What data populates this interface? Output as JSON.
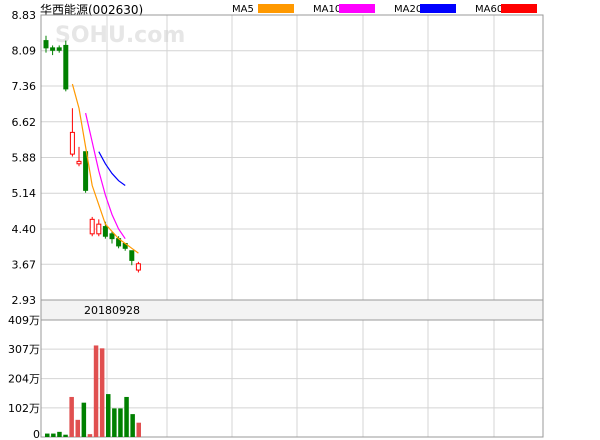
{
  "window": {
    "title": "华西能源(002630)"
  },
  "watermark": "SOHU.com",
  "legend": [
    {
      "label": "MA5",
      "color": "#ff9900"
    },
    {
      "label": "MA10",
      "color": "#ff00ff"
    },
    {
      "label": "MA20",
      "color": "#0000ff"
    },
    {
      "label": "MA60",
      "color": "#ff0000"
    }
  ],
  "date_label": "20180928",
  "colors": {
    "up": "#ff0000",
    "down": "#008000",
    "grid": "#d4d4d4",
    "axis": "#999999",
    "volume_up": "#e05050"
  },
  "chart_data": [
    {
      "type": "candlestick",
      "title": "华西能源(002630)",
      "ylim": [
        2.93,
        8.83
      ],
      "yticks": [
        "8.83",
        "8.09",
        "7.36",
        "6.62",
        "5.88",
        "5.14",
        "4.40",
        "3.67",
        "2.93"
      ],
      "candles": [
        {
          "open": 8.3,
          "close": 8.15,
          "high": 8.4,
          "low": 8.05
        },
        {
          "open": 8.15,
          "close": 8.1,
          "high": 8.2,
          "low": 8.0
        },
        {
          "open": 8.15,
          "close": 8.1,
          "high": 8.2,
          "low": 8.05
        },
        {
          "open": 8.2,
          "close": 7.3,
          "high": 8.3,
          "low": 7.25
        },
        {
          "open": 5.95,
          "close": 6.4,
          "high": 6.9,
          "low": 5.9
        },
        {
          "open": 5.75,
          "close": 5.8,
          "high": 6.1,
          "low": 5.7
        },
        {
          "open": 6.0,
          "close": 5.2,
          "high": 6.0,
          "low": 5.15
        },
        {
          "open": 4.3,
          "close": 4.6,
          "high": 4.65,
          "low": 4.25
        },
        {
          "open": 4.3,
          "close": 4.5,
          "high": 4.6,
          "low": 4.25
        },
        {
          "open": 4.45,
          "close": 4.25,
          "high": 4.55,
          "low": 4.2
        },
        {
          "open": 4.3,
          "close": 4.2,
          "high": 4.35,
          "low": 4.1
        },
        {
          "open": 4.2,
          "close": 4.05,
          "high": 4.25,
          "low": 4.0
        },
        {
          "open": 4.1,
          "close": 4.0,
          "high": 4.1,
          "low": 3.95
        },
        {
          "open": 3.95,
          "close": 3.75,
          "high": 3.95,
          "low": 3.65
        },
        {
          "open": 3.55,
          "close": 3.68,
          "high": 3.72,
          "low": 3.5
        }
      ],
      "ma5": [
        null,
        null,
        null,
        null,
        7.4,
        6.9,
        6.1,
        5.3,
        4.9,
        4.5,
        4.35,
        4.2,
        4.1,
        4.0,
        3.9
      ],
      "ma10": [
        null,
        null,
        null,
        null,
        null,
        null,
        6.8,
        6.2,
        5.6,
        5.1,
        4.7,
        4.4,
        4.2,
        null,
        null
      ],
      "ma20": [
        null,
        null,
        null,
        null,
        null,
        null,
        null,
        null,
        6.0,
        5.75,
        5.55,
        5.4,
        5.3,
        null,
        null
      ]
    },
    {
      "type": "bar",
      "title": "volume",
      "ylim": [
        0,
        409
      ],
      "yticks": [
        "409万",
        "307万",
        "204万",
        "102万",
        "0"
      ],
      "values": [
        12,
        12,
        18,
        8,
        140,
        60,
        120,
        10,
        320,
        310,
        150,
        100,
        100,
        140,
        80,
        50
      ],
      "direction": [
        "down",
        "down",
        "down",
        "down",
        "up",
        "up",
        "down",
        "up",
        "up",
        "up",
        "down",
        "down",
        "down",
        "down",
        "down",
        "up"
      ]
    }
  ]
}
